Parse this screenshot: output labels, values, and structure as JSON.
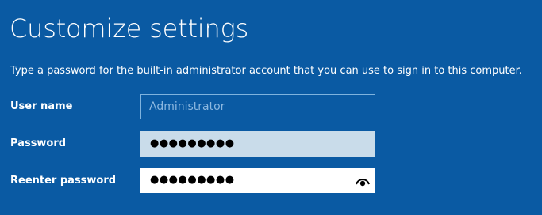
{
  "page": {
    "title": "Customize settings",
    "instruction": "Type a password for the built-in administrator account that you can use to sign in to this computer."
  },
  "form": {
    "username": {
      "label": "User name",
      "value": "Administrator"
    },
    "password": {
      "label": "Password",
      "masked_value": "●●●●●●●●●"
    },
    "reenter_password": {
      "label": "Reenter password",
      "masked_value": "●●●●●●●●●",
      "reveal_icon": "eye-icon"
    }
  },
  "colors": {
    "background": "#0a5aa3",
    "text": "#ffffff",
    "username_border": "#7fb3de",
    "password_field": "#c9dcea",
    "reenter_field": "#ffffff"
  }
}
